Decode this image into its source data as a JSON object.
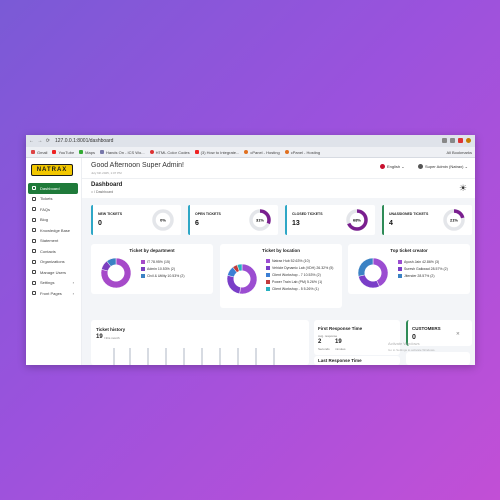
{
  "browser": {
    "url": "127.0.0.1:8001/dashboard",
    "bookmarks": [
      "Gmail",
      "YouTube",
      "Maps",
      "Hands On - ICS Wo...",
      "HTML Color Codes",
      "(3) How to Integrate...",
      "cPanel - Hosting",
      "cPanel - Hosting"
    ],
    "all_bookmarks": "All Bookmarks"
  },
  "app": {
    "logo": "NATRAX",
    "sidebar": [
      {
        "label": "Dashboard",
        "icon": "grid-icon",
        "active": true
      },
      {
        "label": "Tickets",
        "icon": "ticket-icon"
      },
      {
        "label": "FAQs",
        "icon": "faq-icon"
      },
      {
        "label": "Blog",
        "icon": "blog-icon"
      },
      {
        "label": "Knowledge Base",
        "icon": "book-icon"
      },
      {
        "label": "Statement",
        "icon": "statement-icon"
      },
      {
        "label": "Contacts",
        "icon": "contacts-icon"
      },
      {
        "label": "Organizations",
        "icon": "building-icon"
      },
      {
        "label": "Manage Users",
        "icon": "users-icon"
      },
      {
        "label": "Settings",
        "icon": "gear-icon",
        "chevron": true
      },
      {
        "label": "Front Pages",
        "icon": "pages-icon",
        "chevron": true
      }
    ]
  },
  "header": {
    "greeting": "Good Afternoon Super Admin!",
    "date": "July 6th 2025, 1:07 PM",
    "language": "English",
    "user": "Super Admin (Natrax)",
    "page_title": "Dashboard",
    "breadcrumb": "/ Dashboard"
  },
  "stats": [
    {
      "label": "NEW TICKETS",
      "value": "0",
      "percent_label": "0%",
      "percent": 0,
      "color": "#2ea7c6"
    },
    {
      "label": "OPEN TICKETS",
      "value": "6",
      "percent_label": "31%",
      "percent": 31,
      "color": "#2ea7c6"
    },
    {
      "label": "CLOSED TICKETS",
      "value": "13",
      "percent_label": "68%",
      "percent": 68,
      "color": "#2ea7c6"
    },
    {
      "label": "UNASSIGNED TICKETS",
      "value": "4",
      "percent_label": "21%",
      "percent": 21,
      "color": "#2e8b57"
    }
  ],
  "panels": {
    "by_department": {
      "title": "Ticket by department",
      "items": [
        {
          "label": "IT 78.95% (15)",
          "value": 78.95,
          "color": "#a64ac9"
        },
        {
          "label": "Admin 10.53% (2)",
          "value": 10.53,
          "color": "#7b3fbf"
        },
        {
          "label": "Civil & Utility 10.53% (2)",
          "value": 10.53,
          "color": "#3b82c4"
        }
      ]
    },
    "by_location": {
      "title": "Ticket by location",
      "items": [
        {
          "label": "Natrax Hub 52.63% (10)",
          "value": 52.63,
          "color": "#9b4dd1"
        },
        {
          "label": "Vehicle Dynamic Lab (VDH) 26.32% (5)",
          "value": 26.32,
          "color": "#7a3ec8"
        },
        {
          "label": "Client Workshop - 7 10.53% (2)",
          "value": 10.53,
          "color": "#3b7fd4"
        },
        {
          "label": "Power Train Lab (PM) 5.26% (1)",
          "value": 5.26,
          "color": "#c23b3b"
        },
        {
          "label": "Client Workshop - 5 5.26% (1)",
          "value": 5.26,
          "color": "#27b0c0"
        }
      ]
    },
    "top_creator": {
      "title": "Top ticket creator",
      "items": [
        {
          "label": "Ayush Jain 42.86% (3)",
          "value": 42.86,
          "color": "#9b4dd1"
        },
        {
          "label": "Suresh Gaikwad 28.57% (2)",
          "value": 28.57,
          "color": "#7a3ec8"
        },
        {
          "label": "Jitender 28.57% (2)",
          "value": 28.57,
          "color": "#3b82c4"
        }
      ]
    }
  },
  "history": {
    "title": "Ticket history",
    "count": "19",
    "sub": "/ this month"
  },
  "first_response": {
    "title": "First Response Time",
    "subtitle": "Avg. response",
    "seconds": "2",
    "seconds_label": "Seconds",
    "minutes": "19",
    "minutes_label": "minutes"
  },
  "last_response": {
    "title": "Last Response Time"
  },
  "customers": {
    "title": "CUSTOMERS",
    "value": "0"
  },
  "watermark": {
    "line1": "Activate Windows",
    "line2": "Go to Settings to activate Windows."
  }
}
